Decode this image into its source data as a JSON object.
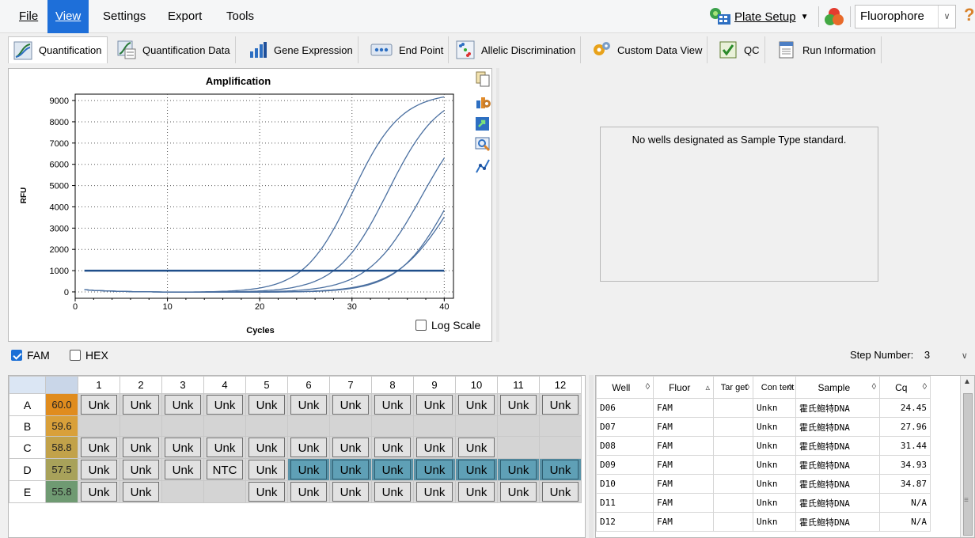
{
  "menu": {
    "items": [
      {
        "label": "File"
      },
      {
        "label": "View"
      },
      {
        "label": "Settings"
      },
      {
        "label": "Export"
      },
      {
        "label": "Tools"
      }
    ],
    "plate_setup_label": "Plate Setup",
    "fluorophore_select": "Fluorophore",
    "help_glyph": "?"
  },
  "tabs": [
    {
      "label": "Quantification",
      "icon": "amplification-chart-icon"
    },
    {
      "label": "Quantification Data",
      "icon": "quantification-data-icon"
    },
    {
      "label": "Gene Expression",
      "icon": "bar-chart-icon"
    },
    {
      "label": "End Point",
      "icon": "end-point-icon"
    },
    {
      "label": "Allelic Discrimination",
      "icon": "scatter-plot-icon"
    },
    {
      "label": "Custom Data View",
      "icon": "gears-icon"
    },
    {
      "label": "QC",
      "icon": "qc-check-icon"
    },
    {
      "label": "Run Information",
      "icon": "document-icon"
    }
  ],
  "chart_data": {
    "type": "line",
    "title": "Amplification",
    "xlabel": "Cycles",
    "ylabel": "RFU",
    "xlim": [
      0,
      41
    ],
    "ylim": [
      -300,
      9300
    ],
    "x_ticks": [
      0,
      10,
      20,
      30,
      40
    ],
    "y_ticks": [
      0,
      1000,
      2000,
      3000,
      4000,
      5000,
      6000,
      7000,
      8000,
      9000
    ],
    "grid": true,
    "threshold": 1000,
    "series_curves": [
      {
        "cq": 24.45,
        "plateau": 9400,
        "k": 0.38
      },
      {
        "cq": 27.96,
        "plateau": 9500,
        "k": 0.36
      },
      {
        "cq": 31.44,
        "plateau": 9100,
        "k": 0.34
      },
      {
        "cq": 34.93,
        "plateau": 8600,
        "k": 0.36
      },
      {
        "cq": 34.87,
        "plateau": 8300,
        "k": 0.33
      }
    ]
  },
  "chart_panel": {
    "log_scale_label": "Log Scale",
    "log_scale_checked": false
  },
  "standard_message": "No wells designated as Sample Type standard.",
  "fluor_bar": {
    "fam_label": "FAM",
    "hex_label": "HEX",
    "step_label": "Step Number:",
    "step_value": "3"
  },
  "plate": {
    "columns": [
      "1",
      "2",
      "3",
      "4",
      "5",
      "6",
      "7",
      "8",
      "9",
      "10",
      "11",
      "12"
    ],
    "rows": [
      {
        "row": "A",
        "temp": "60.0",
        "temp_color": "#e08c1e",
        "wells": [
          "Unk",
          "Unk",
          "Unk",
          "Unk",
          "Unk",
          "Unk",
          "Unk",
          "Unk",
          "Unk",
          "Unk",
          "Unk",
          "Unk"
        ],
        "selected": []
      },
      {
        "row": "B",
        "temp": "59.6",
        "temp_color": "#d9a03a",
        "wells": [
          "",
          "",
          "",
          "",
          "",
          "",
          "",
          "",
          "",
          "",
          "",
          ""
        ],
        "selected": []
      },
      {
        "row": "C",
        "temp": "58.8",
        "temp_color": "#c2a24a",
        "wells": [
          "Unk",
          "Unk",
          "Unk",
          "Unk",
          "Unk",
          "Unk",
          "Unk",
          "Unk",
          "Unk",
          "Unk",
          "",
          ""
        ],
        "selected": []
      },
      {
        "row": "D",
        "temp": "57.5",
        "temp_color": "#a8a25a",
        "wells": [
          "Unk",
          "Unk",
          "Unk",
          "NTC",
          "Unk",
          "Unk",
          "Unk",
          "Unk",
          "Unk",
          "Unk",
          "Unk",
          "Unk"
        ],
        "selected": [
          5,
          6,
          7,
          8,
          9,
          10,
          11
        ]
      },
      {
        "row": "E",
        "temp": "55.8",
        "temp_color": "#6f9a72",
        "wells": [
          "Unk",
          "Unk",
          "",
          "",
          "Unk",
          "Unk",
          "Unk",
          "Unk",
          "Unk",
          "Unk",
          "Unk",
          "Unk"
        ],
        "selected": []
      }
    ]
  },
  "results": {
    "headers": [
      "Well",
      "Fluor",
      "Tar get",
      "Con tent",
      "Sample",
      "Cq"
    ],
    "rows": [
      [
        "D06",
        "FAM",
        "",
        "Unkn",
        "霍氏鲍特DNA",
        "24.45"
      ],
      [
        "D07",
        "FAM",
        "",
        "Unkn",
        "霍氏鲍特DNA",
        "27.96"
      ],
      [
        "D08",
        "FAM",
        "",
        "Unkn",
        "霍氏鲍特DNA",
        "31.44"
      ],
      [
        "D09",
        "FAM",
        "",
        "Unkn",
        "霍氏鲍特DNA",
        "34.93"
      ],
      [
        "D10",
        "FAM",
        "",
        "Unkn",
        "霍氏鲍特DNA",
        "34.87"
      ],
      [
        "D11",
        "FAM",
        "",
        "Unkn",
        "霍氏鲍特DNA",
        "N/A"
      ],
      [
        "D12",
        "FAM",
        "",
        "Unkn",
        "霍氏鲍特DNA",
        "N/A"
      ]
    ]
  },
  "colors": {
    "accent": "#1e6fd9",
    "curve": "#4a6fa0",
    "threshold": "#1f4e8a",
    "selected_well": "#5fa0b6"
  }
}
